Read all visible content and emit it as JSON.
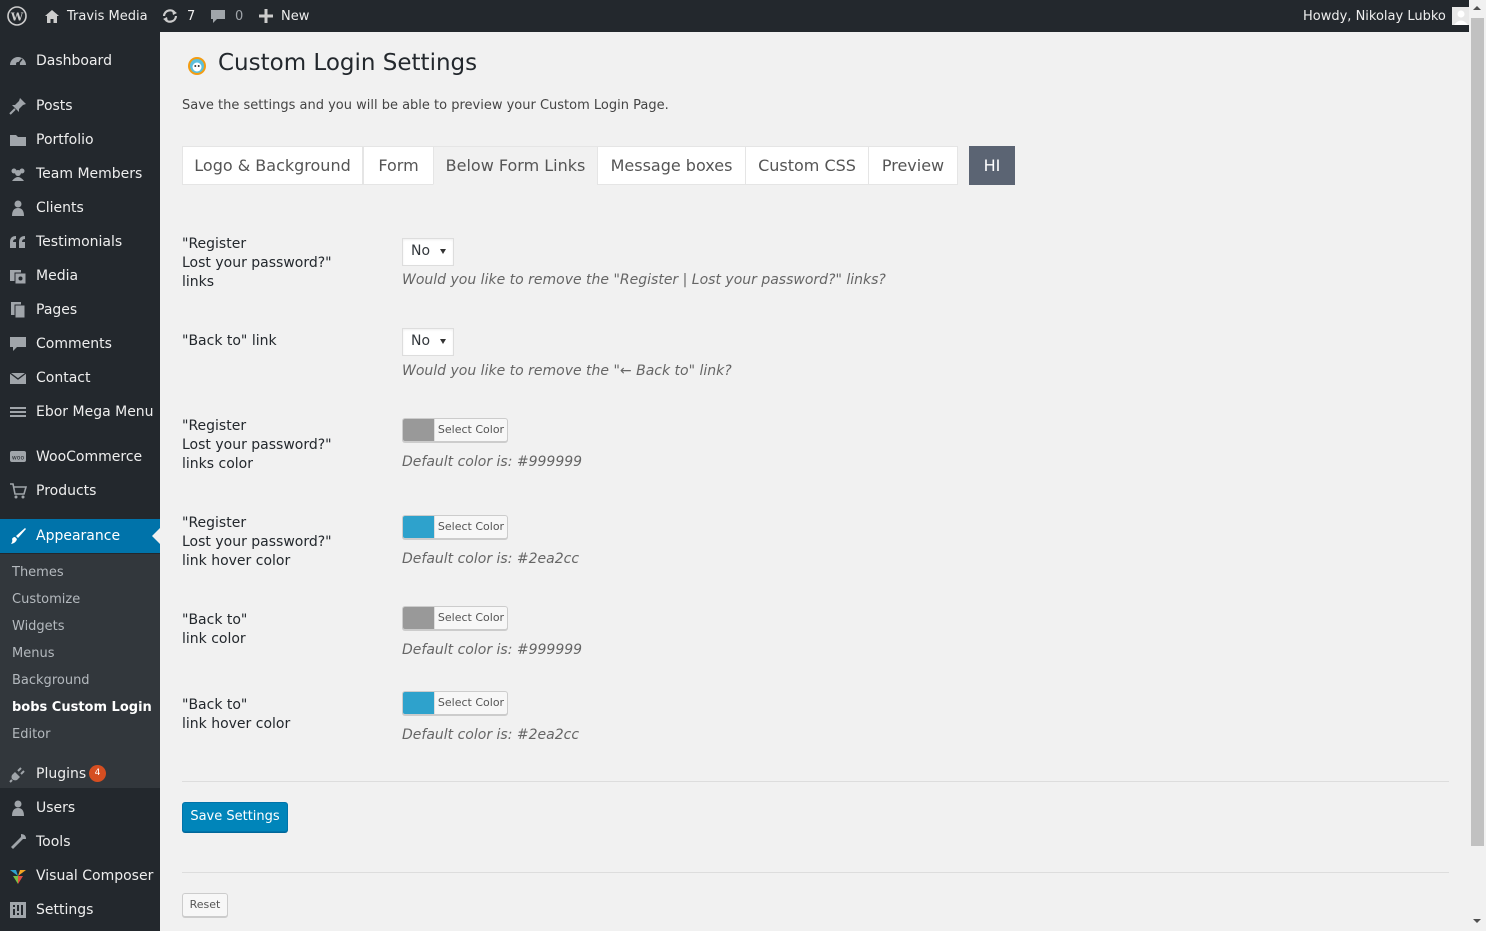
{
  "admin_bar": {
    "site_name": "Travis Media",
    "updates_count": "7",
    "comments_count": "0",
    "new_label": "New",
    "greeting": "Howdy, Nikolay Lubko"
  },
  "sidebar": {
    "items": [
      {
        "label": "Dashboard",
        "icon": "dashboard-icon"
      },
      {
        "label": "Posts",
        "icon": "pin-icon"
      },
      {
        "label": "Portfolio",
        "icon": "folder-icon"
      },
      {
        "label": "Team Members",
        "icon": "group-icon"
      },
      {
        "label": "Clients",
        "icon": "user-icon"
      },
      {
        "label": "Testimonials",
        "icon": "quote-icon"
      },
      {
        "label": "Media",
        "icon": "media-icon"
      },
      {
        "label": "Pages",
        "icon": "pages-icon"
      },
      {
        "label": "Comments",
        "icon": "comment-icon"
      },
      {
        "label": "Contact",
        "icon": "envelope-icon"
      },
      {
        "label": "Ebor Mega Menu",
        "icon": "menu-icon"
      },
      {
        "label": "WooCommerce",
        "icon": "woo-icon"
      },
      {
        "label": "Products",
        "icon": "cart-icon"
      },
      {
        "label": "Appearance",
        "icon": "brush-icon"
      },
      {
        "label": "Plugins",
        "icon": "plug-icon",
        "badge": "4"
      },
      {
        "label": "Users",
        "icon": "user-icon"
      },
      {
        "label": "Tools",
        "icon": "wrench-icon"
      },
      {
        "label": "Visual Composer",
        "icon": "vc-icon"
      },
      {
        "label": "Settings",
        "icon": "sliders-icon"
      }
    ],
    "submenu": [
      "Themes",
      "Customize",
      "Widgets",
      "Menus",
      "Background",
      "bobs Custom Login",
      "Editor"
    ]
  },
  "page": {
    "title": "Custom Login Settings",
    "intro": "Save the settings and you will be able to preview your Custom Login Page.",
    "tabs": [
      "Logo & Background",
      "Form",
      "Below Form Links",
      "Message boxes",
      "Custom CSS",
      "Preview",
      "HI"
    ],
    "active_tab": "Below Form Links"
  },
  "fields": [
    {
      "label": "\"Register\nLost your password?\"\nlinks",
      "select_value": "No",
      "description": "Would you like to remove the \"Register | Lost your password?\" links?"
    },
    {
      "label": "\"Back to\" link",
      "select_value": "No",
      "description": "Would you like to remove the \"← Back to\" link?"
    },
    {
      "label": "\"Register\nLost your password?\"\nlinks color",
      "button_label": "Select Color",
      "color": "#999999",
      "description": "Default color is: #999999"
    },
    {
      "label": "\"Register\nLost your password?\"\nlink hover color",
      "button_label": "Select Color",
      "color": "#2ea2cc",
      "description": "Default color is: #2ea2cc"
    },
    {
      "label": "\"Back to\"\nlink color",
      "button_label": "Select Color",
      "color": "#999999",
      "description": "Default color is: #999999"
    },
    {
      "label": "\"Back to\"\nlink hover color",
      "button_label": "Select Color",
      "color": "#2ea2cc",
      "description": "Default color is: #2ea2cc"
    }
  ],
  "buttons": {
    "save": "Save Settings",
    "reset": "Reset"
  },
  "colors": {
    "admin_dark": "#23282d",
    "accent_blue": "#0073aa",
    "primary_button": "#0085ba",
    "tab_hi": "#5b6473",
    "badge_red": "#d54e21"
  }
}
